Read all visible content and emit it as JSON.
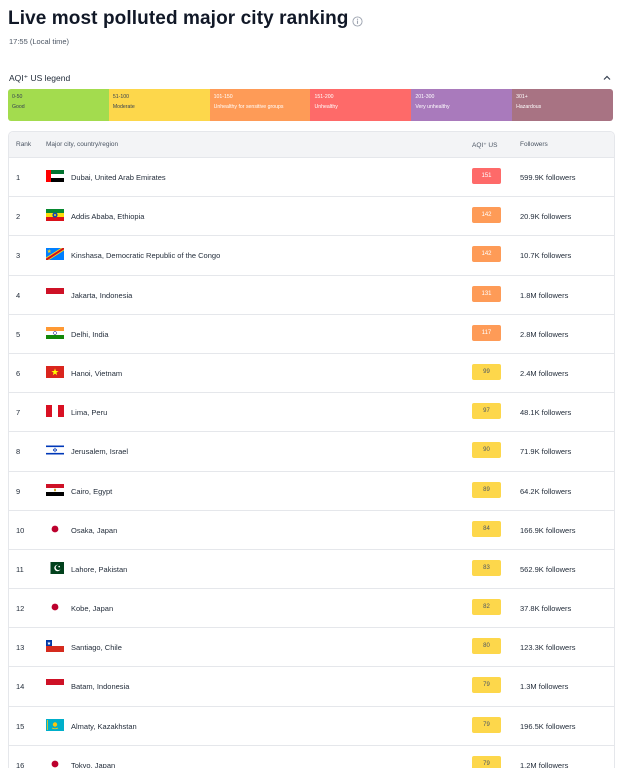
{
  "header": {
    "title": "Live most polluted major city ranking",
    "time": "17:55 (Local time)"
  },
  "legend": {
    "title": "AQI⁺ US legend",
    "segments": [
      {
        "range": "0-50",
        "label": "Good",
        "color": "#a3dc4e",
        "text": "#374151"
      },
      {
        "range": "51-100",
        "label": "Moderate",
        "color": "#fdd74b",
        "text": "#374151"
      },
      {
        "range": "101-150",
        "label": "Unhealthy for sensitive groups",
        "color": "#fe9b57",
        "text": "#ffffff"
      },
      {
        "range": "151-200",
        "label": "Unhealthy",
        "color": "#fe6a69",
        "text": "#ffffff"
      },
      {
        "range": "201-300",
        "label": "Very unhealthy",
        "color": "#a97abc",
        "text": "#ffffff"
      },
      {
        "range": "301+",
        "label": "Hazardous",
        "color": "#a87383",
        "text": "#ffffff"
      }
    ]
  },
  "table": {
    "headers": {
      "rank": "Rank",
      "city": "Major city, country/region",
      "aqi": "AQI⁺ US",
      "followers": "Followers"
    },
    "rows": [
      {
        "rank": "1",
        "city": "Dubai, United Arab Emirates",
        "aqi": "151",
        "followers": "599.9K followers",
        "flag": "ae"
      },
      {
        "rank": "2",
        "city": "Addis Ababa, Ethiopia",
        "aqi": "142",
        "followers": "20.9K followers",
        "flag": "et"
      },
      {
        "rank": "3",
        "city": "Kinshasa, Democratic Republic of the Congo",
        "aqi": "142",
        "followers": "10.7K followers",
        "flag": "cd"
      },
      {
        "rank": "4",
        "city": "Jakarta, Indonesia",
        "aqi": "131",
        "followers": "1.8M followers",
        "flag": "id"
      },
      {
        "rank": "5",
        "city": "Delhi, India",
        "aqi": "117",
        "followers": "2.8M followers",
        "flag": "in"
      },
      {
        "rank": "6",
        "city": "Hanoi, Vietnam",
        "aqi": "99",
        "followers": "2.4M followers",
        "flag": "vn"
      },
      {
        "rank": "7",
        "city": "Lima, Peru",
        "aqi": "97",
        "followers": "48.1K followers",
        "flag": "pe"
      },
      {
        "rank": "8",
        "city": "Jerusalem, Israel",
        "aqi": "90",
        "followers": "71.9K followers",
        "flag": "il"
      },
      {
        "rank": "9",
        "city": "Cairo, Egypt",
        "aqi": "89",
        "followers": "64.2K followers",
        "flag": "eg"
      },
      {
        "rank": "10",
        "city": "Osaka, Japan",
        "aqi": "84",
        "followers": "166.9K followers",
        "flag": "jp"
      },
      {
        "rank": "11",
        "city": "Lahore, Pakistan",
        "aqi": "83",
        "followers": "562.9K followers",
        "flag": "pk"
      },
      {
        "rank": "12",
        "city": "Kobe, Japan",
        "aqi": "82",
        "followers": "37.8K followers",
        "flag": "jp"
      },
      {
        "rank": "13",
        "city": "Santiago, Chile",
        "aqi": "80",
        "followers": "123.3K followers",
        "flag": "cl"
      },
      {
        "rank": "14",
        "city": "Batam, Indonesia",
        "aqi": "79",
        "followers": "1.3M followers",
        "flag": "id"
      },
      {
        "rank": "15",
        "city": "Almaty, Kazakhstan",
        "aqi": "79",
        "followers": "196.5K followers",
        "flag": "kz"
      },
      {
        "rank": "16",
        "city": "Tokyo, Japan",
        "aqi": "79",
        "followers": "1.2M followers",
        "flag": "jp"
      }
    ]
  },
  "colors": {
    "unhealthy": "#fe6a69",
    "sensitive": "#fe9b57",
    "moderate": "#fdd74b"
  },
  "icons": {
    "info": "info-icon",
    "collapse": "chevron-up-icon"
  }
}
